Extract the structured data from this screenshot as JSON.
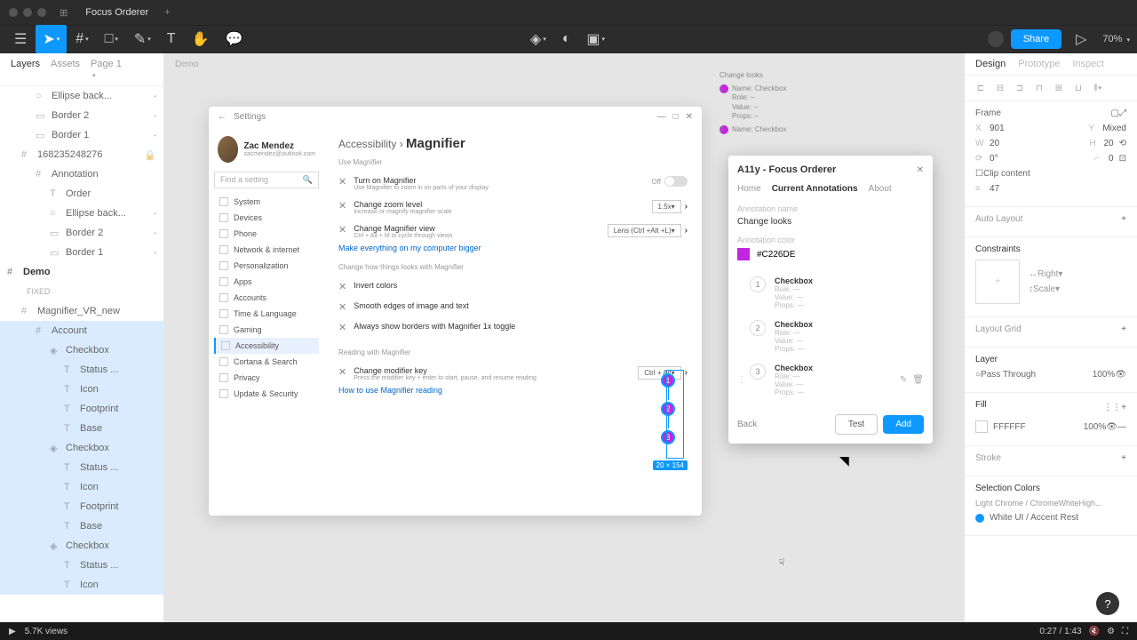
{
  "titlebar": {
    "title": "Focus Orderer"
  },
  "toolbar": {
    "share": "Share",
    "zoom": "70%"
  },
  "left": {
    "tab_layers": "Layers",
    "tab_assets": "Assets",
    "page": "Page 1",
    "fixed": "FIXED",
    "items": [
      {
        "icon": "ellipse",
        "label": "Ellipse back...",
        "dot": true,
        "indent": 2
      },
      {
        "icon": "rect",
        "label": "Border 2",
        "dot": true,
        "indent": 2
      },
      {
        "icon": "rect",
        "label": "Border 1",
        "dot": true,
        "indent": 2
      },
      {
        "icon": "frame",
        "label": "168235248276",
        "lock": true,
        "indent": 1
      },
      {
        "icon": "frame",
        "label": "Annotation",
        "indent": 2
      },
      {
        "icon": "text",
        "label": "Order",
        "indent": 3
      },
      {
        "icon": "ellipse",
        "label": "Ellipse back...",
        "dot": true,
        "indent": 3
      },
      {
        "icon": "rect",
        "label": "Border 2",
        "dot": true,
        "indent": 3
      },
      {
        "icon": "rect",
        "label": "Border 1",
        "dot": true,
        "indent": 3
      }
    ],
    "demo": "Demo",
    "tree": [
      {
        "icon": "frame",
        "label": "Magnifier_VR_new",
        "indent": 1
      },
      {
        "icon": "frame",
        "label": "Account",
        "indent": 2,
        "sel": true
      },
      {
        "icon": "comp",
        "label": "Checkbox",
        "indent": 3,
        "sel": true
      },
      {
        "icon": "text",
        "label": "Status ...",
        "indent": 4,
        "sel": true
      },
      {
        "icon": "text",
        "label": "Icon",
        "indent": 4,
        "sel": true
      },
      {
        "icon": "text",
        "label": "Footprint",
        "indent": 4,
        "sel": true
      },
      {
        "icon": "text",
        "label": "Base",
        "indent": 4,
        "sel": true
      },
      {
        "icon": "comp",
        "label": "Checkbox",
        "indent": 3,
        "sel": true
      },
      {
        "icon": "text",
        "label": "Status ...",
        "indent": 4,
        "sel": true
      },
      {
        "icon": "text",
        "label": "Icon",
        "indent": 4,
        "sel": true
      },
      {
        "icon": "text",
        "label": "Footprint",
        "indent": 4,
        "sel": true
      },
      {
        "icon": "text",
        "label": "Base",
        "indent": 4,
        "sel": true
      },
      {
        "icon": "comp",
        "label": "Checkbox",
        "indent": 3,
        "sel": true
      },
      {
        "icon": "text",
        "label": "Status ...",
        "indent": 4,
        "sel": true
      },
      {
        "icon": "text",
        "label": "Icon",
        "indent": 4,
        "sel": true
      }
    ]
  },
  "settings": {
    "back": "←",
    "title": "Settings",
    "profile": {
      "name": "Zac Mendez",
      "email": "zacmendez@outlook.com"
    },
    "search": "Find a setting",
    "nav": [
      "System",
      "Devices",
      "Phone",
      "Network & internet",
      "Personalization",
      "Apps",
      "Accounts",
      "Time & Language",
      "Gaming",
      "Accessibility",
      "Cortana & Search",
      "Privacy",
      "Update & Security"
    ],
    "bc1": "Accessibility",
    "bc2": "Magnifier",
    "s1": "Use Magnifier",
    "row1": {
      "t": "Turn on Magnifier",
      "s": "Use Magnifier to zoom in on parts of your display",
      "off": "Off"
    },
    "row2": {
      "t": "Change zoom level",
      "s": "Increase or magnify magnifier scale",
      "v": "1.5x"
    },
    "row3": {
      "t": "Change Magnifier view",
      "s": "Ctrl + Alt + M to cycle through views",
      "v": "Lens (Ctrl +Alt +L)"
    },
    "link1": "Make everything on my computer bigger",
    "s2": "Change how things looks with Magnifier",
    "row4": "Invert colors",
    "row5": "Smooth edges of image and text",
    "row6": "Always show borders with Magnifier 1x toggle",
    "s3": "Reading with Magnifier",
    "row7": {
      "t": "Change modifier key",
      "s": "Press the modifier key + enter to start, pause, and resume reading",
      "v": "Ctrl + Alt"
    },
    "link2": "How to use Magnifier reading",
    "dim": "20 × 154"
  },
  "sidepanel": {
    "title": "Change looks",
    "items": [
      {
        "name": "Checkbox",
        "role": "Role: –",
        "value": "Value: –",
        "props": "Props: –"
      },
      {
        "name": "Checkbox"
      }
    ]
  },
  "plugin": {
    "title": "A11y - Focus Orderer",
    "tabs": {
      "home": "Home",
      "current": "Current Annotations",
      "about": "About"
    },
    "name_label": "Annotation name",
    "name": "Change looks",
    "color_label": "Annotation color",
    "color": "#C226DE",
    "items": [
      {
        "n": "1",
        "name": "Checkbox",
        "role": "Role:   —",
        "value": "Value:   —",
        "props": "Props:   —"
      },
      {
        "n": "2",
        "name": "Checkbox",
        "role": "Role:   —",
        "value": "Value:   —",
        "props": "Props:   —"
      },
      {
        "n": "3",
        "name": "Checkbox",
        "role": "Role:   —",
        "value": "Value:   —",
        "props": "Props:   —"
      }
    ],
    "back": "Back",
    "test": "Test",
    "add": "Add"
  },
  "right": {
    "tabs": {
      "design": "Design",
      "prototype": "Prototype",
      "inspect": "Inspect"
    },
    "frame": "Frame",
    "x": "901",
    "y": "Mixed",
    "w": "20",
    "h": "20",
    "r": "0°",
    "rc": "0",
    "clip": "Clip content",
    "reorder": "47",
    "auto": "Auto Layout",
    "constraints": "Constraints",
    "c1": "Right",
    "c2": "Scale",
    "grid": "Layout Grid",
    "layer": "Layer",
    "pass": "Pass Through",
    "pct": "100%",
    "fill": "Fill",
    "fillv": "FFFFFF",
    "fillpct": "100%",
    "stroke": "Stroke",
    "selcolors": "Selection Colors",
    "sc1": "Light Chrome / ChromeWhiteHigh...",
    "sc2": "White UI / Accent Rest"
  },
  "video": {
    "views": "5.7K views",
    "time": "0:27 / 1:43"
  }
}
